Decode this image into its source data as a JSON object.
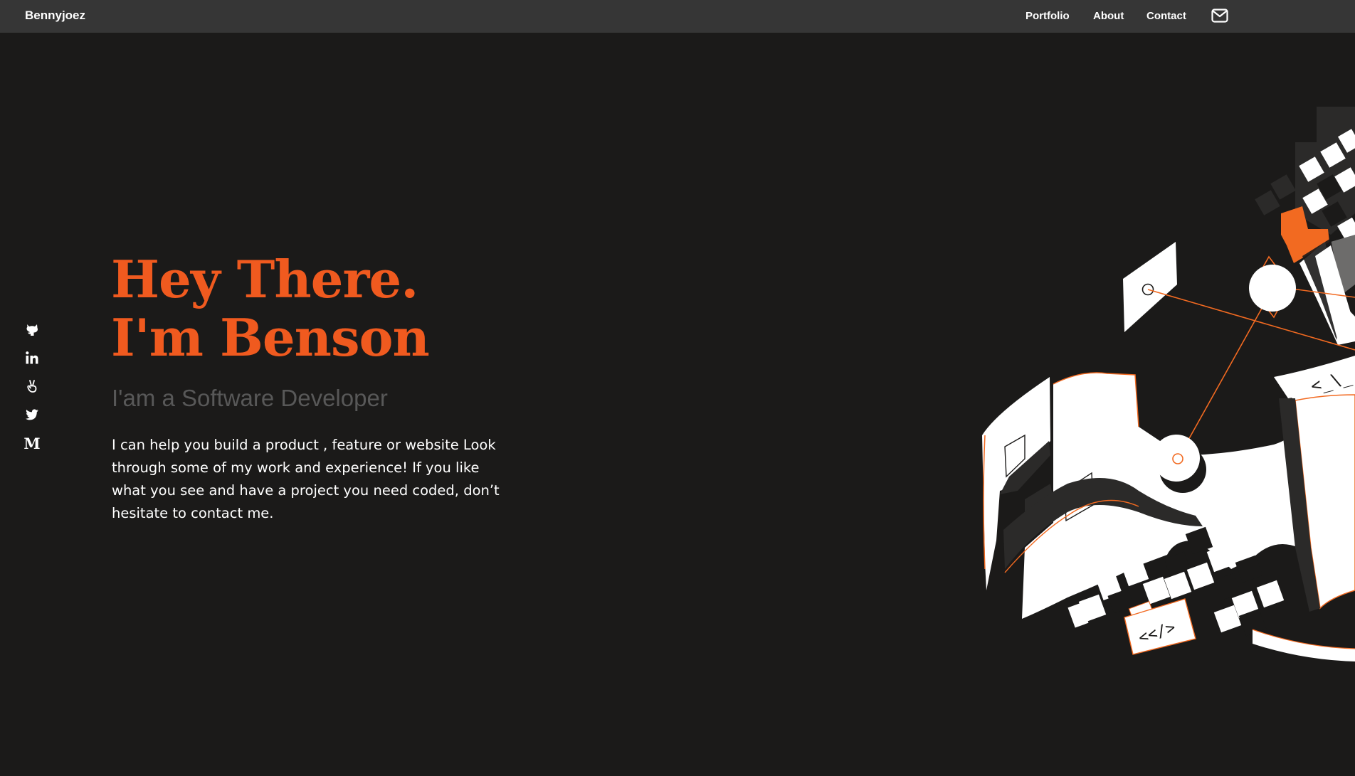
{
  "nav": {
    "brand": "Bennyjoez",
    "links": [
      "Portfolio",
      "About",
      "Contact"
    ],
    "mail_icon": "envelope-icon"
  },
  "social": [
    {
      "name": "github",
      "icon": "github-icon"
    },
    {
      "name": "linkedin",
      "icon": "linkedin-icon"
    },
    {
      "name": "angellist",
      "icon": "angellist-icon"
    },
    {
      "name": "twitter",
      "icon": "twitter-icon"
    },
    {
      "name": "medium",
      "icon": "medium-icon",
      "glyph": "M"
    }
  ],
  "hero": {
    "line1": "Hey There.",
    "line2": "I'm Benson",
    "subtitle": "I'am a Software Developer",
    "description": "I can help you build a product , feature or website Look through some of my work and experience! If you like what you see and have a project you need coded, don’t hesitate to contact me."
  },
  "illustration": {
    "code_tag_1": "<_\\_",
    "code_tag_2": "<</>"
  },
  "colors": {
    "background": "#1b1a19",
    "navbar": "#363636",
    "accent": "#f05a1f",
    "subtitle": "#585858",
    "text": "#ffffff"
  }
}
